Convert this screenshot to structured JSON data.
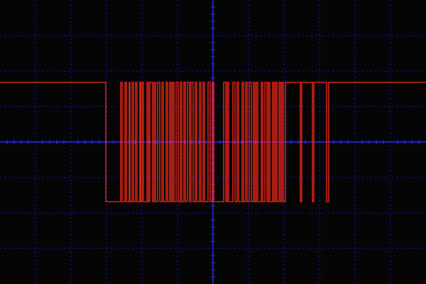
{
  "chart_data": {
    "type": "line",
    "title": "",
    "xlabel": "",
    "ylabel": "",
    "xlim": [
      0,
      12
    ],
    "ylim": [
      -4,
      4
    ],
    "grid": true,
    "grid_divisions": {
      "x": 12,
      "y": 8,
      "minor_per_division": 5
    },
    "colors": {
      "background": "#050505",
      "grid": "#1a1aff",
      "axis": "#2a2aff",
      "trace": "#ff2a1a"
    },
    "levels": {
      "high": 1.68,
      "low": -1.68
    },
    "series": [
      {
        "step_transitions": [
          [
            0,
            1.68
          ],
          [
            2.98,
            -1.68
          ],
          [
            3.4,
            1.68
          ],
          [
            3.44,
            -1.68
          ],
          [
            3.52,
            1.68
          ],
          [
            3.56,
            -1.68
          ],
          [
            3.64,
            1.68
          ],
          [
            3.66,
            -1.68
          ],
          [
            3.72,
            1.68
          ],
          [
            3.76,
            -1.68
          ],
          [
            3.82,
            1.68
          ],
          [
            3.86,
            -1.68
          ],
          [
            3.94,
            1.68
          ],
          [
            3.96,
            -1.68
          ],
          [
            4.0,
            1.68
          ],
          [
            4.04,
            -1.68
          ],
          [
            4.14,
            1.68
          ],
          [
            4.18,
            -1.68
          ],
          [
            4.22,
            1.68
          ],
          [
            4.3,
            -1.68
          ],
          [
            4.34,
            1.68
          ],
          [
            4.38,
            -1.68
          ],
          [
            4.44,
            1.68
          ],
          [
            4.5,
            -1.68
          ],
          [
            4.56,
            1.68
          ],
          [
            4.6,
            -1.68
          ],
          [
            4.68,
            1.68
          ],
          [
            4.72,
            -1.68
          ],
          [
            4.78,
            1.68
          ],
          [
            4.82,
            -1.68
          ],
          [
            4.86,
            1.68
          ],
          [
            4.9,
            -1.68
          ],
          [
            4.96,
            1.68
          ],
          [
            5.02,
            -1.68
          ],
          [
            5.08,
            1.68
          ],
          [
            5.12,
            -1.68
          ],
          [
            5.18,
            1.68
          ],
          [
            5.22,
            -1.68
          ],
          [
            5.28,
            1.68
          ],
          [
            5.34,
            -1.68
          ],
          [
            5.38,
            1.68
          ],
          [
            5.44,
            -1.68
          ],
          [
            5.5,
            1.68
          ],
          [
            5.54,
            -1.68
          ],
          [
            5.62,
            1.68
          ],
          [
            5.66,
            -1.68
          ],
          [
            5.72,
            1.68
          ],
          [
            5.76,
            -1.68
          ],
          [
            5.86,
            1.68
          ],
          [
            5.92,
            -1.68
          ],
          [
            5.98,
            1.68
          ],
          [
            6.02,
            -1.68
          ],
          [
            6.3,
            1.68
          ],
          [
            6.36,
            -1.68
          ],
          [
            6.4,
            1.68
          ],
          [
            6.44,
            -1.68
          ],
          [
            6.56,
            1.68
          ],
          [
            6.62,
            -1.68
          ],
          [
            6.68,
            1.68
          ],
          [
            6.72,
            -1.68
          ],
          [
            6.82,
            1.68
          ],
          [
            6.86,
            -1.68
          ],
          [
            6.92,
            1.68
          ],
          [
            6.96,
            -1.68
          ],
          [
            7.02,
            1.68
          ],
          [
            7.08,
            -1.68
          ],
          [
            7.14,
            1.68
          ],
          [
            7.18,
            -1.68
          ],
          [
            7.22,
            1.68
          ],
          [
            7.26,
            -1.68
          ],
          [
            7.36,
            1.68
          ],
          [
            7.4,
            -1.68
          ],
          [
            7.46,
            1.68
          ],
          [
            7.52,
            -1.68
          ],
          [
            7.56,
            1.68
          ],
          [
            7.6,
            -1.68
          ],
          [
            7.68,
            1.68
          ],
          [
            7.72,
            -1.68
          ],
          [
            7.76,
            1.68
          ],
          [
            7.8,
            -1.68
          ],
          [
            7.86,
            1.68
          ],
          [
            7.9,
            -1.68
          ],
          [
            7.94,
            1.68
          ],
          [
            7.98,
            -1.68
          ],
          [
            8.04,
            1.68
          ],
          [
            8.46,
            -1.68
          ],
          [
            8.5,
            1.68
          ],
          [
            8.8,
            -1.68
          ],
          [
            8.84,
            1.68
          ],
          [
            9.2,
            -1.68
          ],
          [
            9.26,
            1.68
          ],
          [
            12,
            1.68
          ]
        ]
      }
    ]
  }
}
